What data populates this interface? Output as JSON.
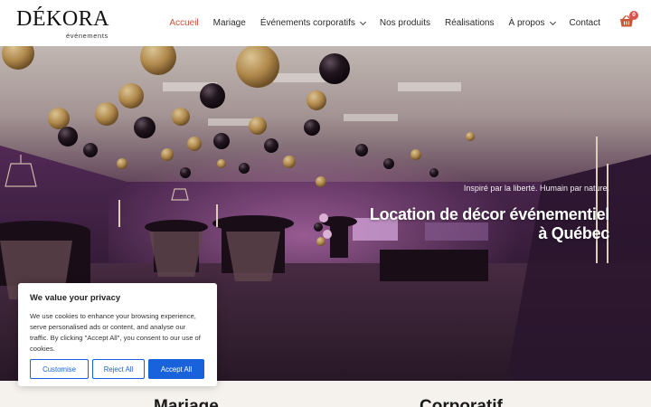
{
  "brand": {
    "name": "DÉKORA",
    "subtitle": "événements"
  },
  "nav": {
    "items": [
      {
        "label": "Accueil",
        "active": true,
        "dropdown": false
      },
      {
        "label": "Mariage",
        "active": false,
        "dropdown": false
      },
      {
        "label": "Événements corporatifs",
        "active": false,
        "dropdown": true
      },
      {
        "label": "Nos produits",
        "active": false,
        "dropdown": false
      },
      {
        "label": "Réalisations",
        "active": false,
        "dropdown": false
      },
      {
        "label": "À propos",
        "active": false,
        "dropdown": true
      },
      {
        "label": "Contact",
        "active": false,
        "dropdown": false
      }
    ],
    "cart_icon": "basket-icon",
    "cart_count": "0"
  },
  "hero": {
    "tagline": "Inspiré par la liberté. Humain par nature.",
    "title_line1": "Location de décor événementiel",
    "title_line2": "à Québec"
  },
  "sections": {
    "left_title": "Mariage",
    "right_title": "Corporatif"
  },
  "cookie": {
    "title": "We value your privacy",
    "body": "We use cookies to enhance your browsing experience, serve personalised ads or content, and analyse our traffic. By clicking \"Accept All\", you consent to our use of cookies.",
    "customise": "Customise",
    "reject": "Reject All",
    "accept": "Accept All"
  },
  "colors": {
    "accent_nav": "#c8573a",
    "cookie_blue": "#1863dc",
    "badge": "#d9534f"
  }
}
